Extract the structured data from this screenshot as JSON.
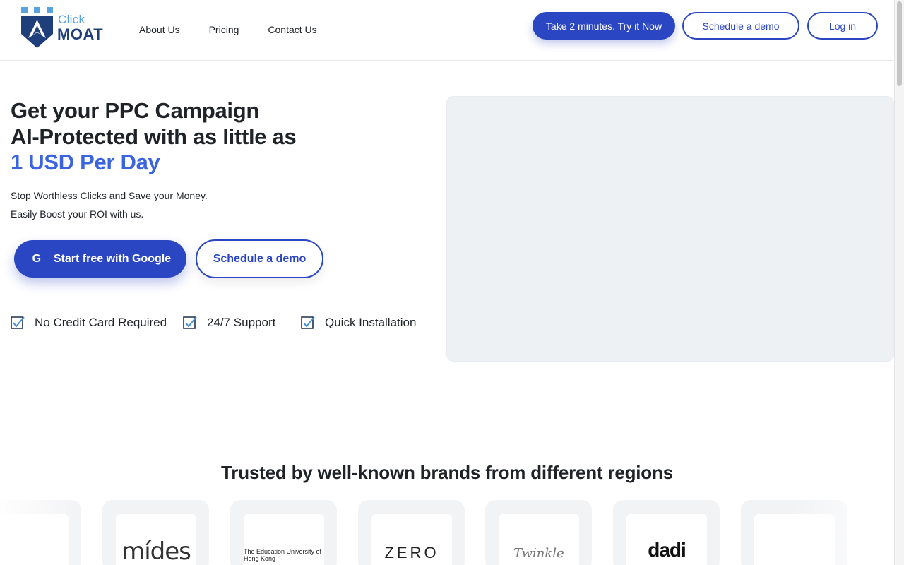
{
  "header": {
    "logo": {
      "line1": "Click",
      "line2": "MOAT"
    },
    "nav": [
      {
        "label": "About Us"
      },
      {
        "label": "Pricing"
      },
      {
        "label": "Contact Us"
      }
    ],
    "try_button": "Take 2 minutes. Try it Now",
    "demo_button": "Schedule a demo",
    "login_button": "Log in"
  },
  "hero": {
    "title_line1": "Get your PPC Campaign",
    "title_line2": "AI-Protected with as little as",
    "title_accent": "1 USD Per Day",
    "subtitle1": "Stop Worthless Clicks and Save your Money.",
    "subtitle2": "Easily Boost your ROI with us.",
    "google_button": "Start free with Google",
    "google_icon": "G",
    "demo_button": "Schedule a demo",
    "features": [
      {
        "label": "No Credit Card Required"
      },
      {
        "label": "24/7 Support"
      },
      {
        "label": "Quick Installation"
      }
    ]
  },
  "brands": {
    "title": "Trusted by well-known brands from different regions",
    "logos": [
      {
        "name": "mides",
        "text": "mídes"
      },
      {
        "name": "education-university-hong-kong",
        "text": "The Education University of Hong Kong"
      },
      {
        "name": "zero-finance",
        "text": "ZERO"
      },
      {
        "name": "twinkle",
        "text": "Twinkle"
      },
      {
        "name": "dadi",
        "text": "dadi"
      }
    ]
  },
  "colors": {
    "primary": "#2b46c2",
    "accent": "#3b64e0",
    "media_placeholder": "#eef1f4"
  }
}
